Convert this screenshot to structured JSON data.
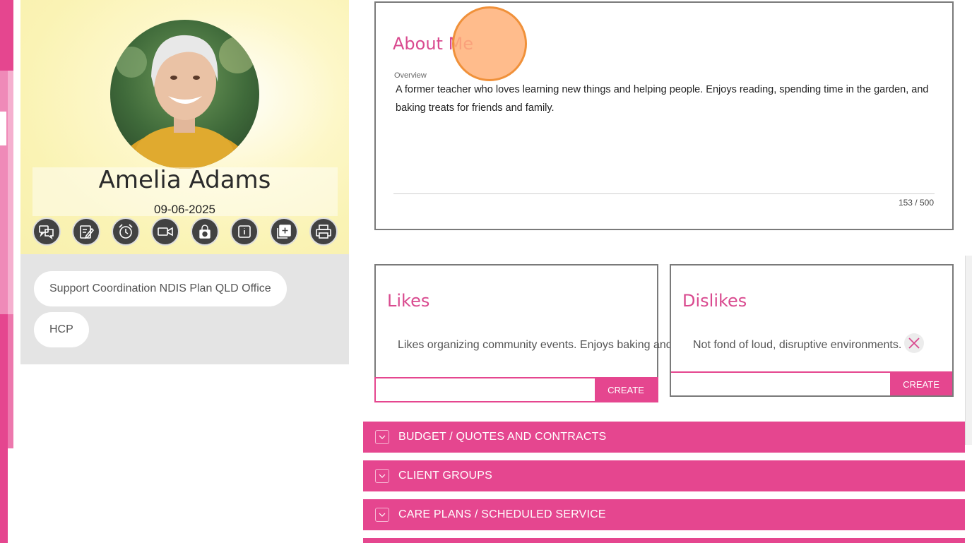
{
  "profile": {
    "name": "Amelia Adams",
    "date": "09-06-2025",
    "actions": [
      {
        "icon": "chat-icon"
      },
      {
        "icon": "edit-note-icon"
      },
      {
        "icon": "alarm-clock-icon"
      },
      {
        "icon": "video-camera-icon"
      },
      {
        "icon": "lock-refresh-icon"
      },
      {
        "icon": "info-icon"
      },
      {
        "icon": "add-document-icon"
      },
      {
        "icon": "printer-icon"
      }
    ],
    "tags": [
      "Support Coordination NDIS Plan QLD Office",
      "HCP"
    ]
  },
  "about": {
    "title": "About Me",
    "overview_label": "Overview",
    "overview_text": "A former teacher who loves learning new things and helping people. Enjoys reading, spending time in the garden, and baking treats for friends and family.",
    "counter": "153 / 500"
  },
  "likes": {
    "title": "Likes",
    "item": "Likes organizing community events. Enjoys baking and trying new recipes.",
    "create_label": "CREATE"
  },
  "dislikes": {
    "title": "Dislikes",
    "item": "Not fond of loud, disruptive environments.",
    "create_label": "CREATE"
  },
  "sections": [
    {
      "label": "BUDGET / QUOTES AND CONTRACTS"
    },
    {
      "label": "CLIENT GROUPS"
    },
    {
      "label": "CARE PLANS / SCHEDULED SERVICE"
    }
  ],
  "colors": {
    "accent": "#e5468f",
    "title": "#d94a8f"
  }
}
